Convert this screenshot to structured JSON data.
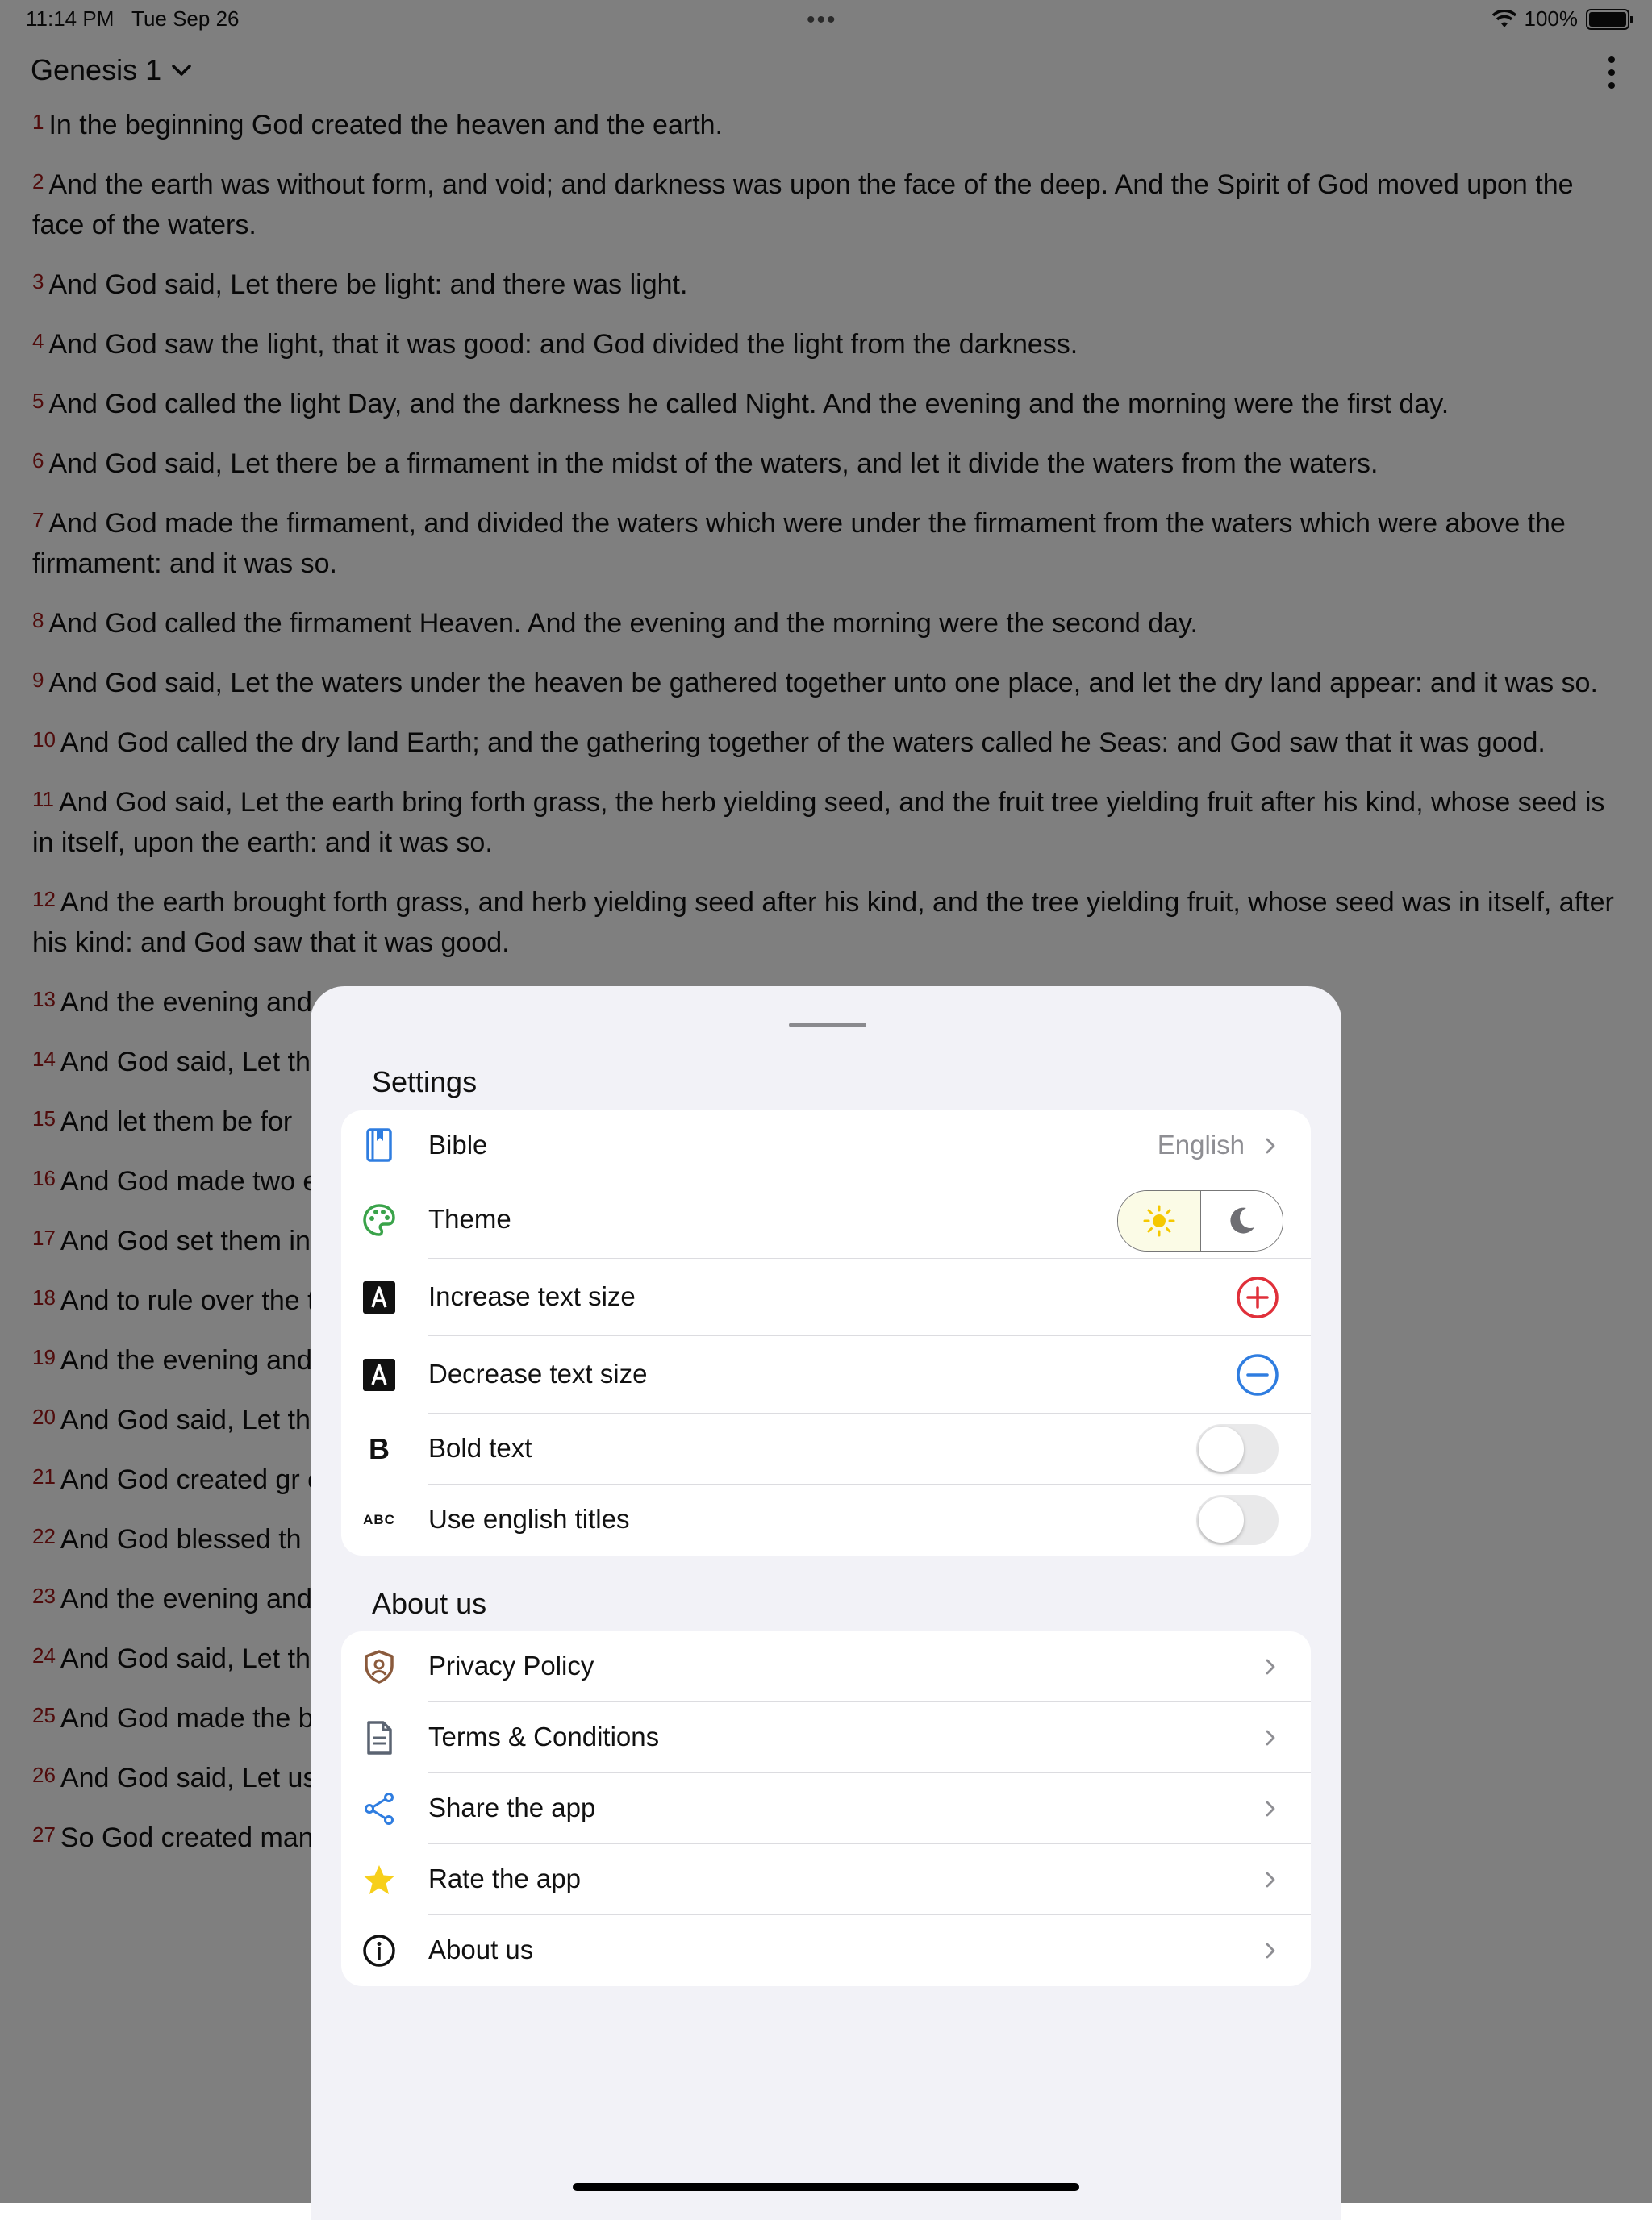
{
  "status_bar": {
    "time": "11:14 PM",
    "date": "Tue Sep 26",
    "dots": "•••",
    "battery": "100%"
  },
  "header": {
    "book_chapter": "Genesis 1"
  },
  "verses": [
    {
      "n": "1",
      "t": "In the beginning God created the heaven and the earth."
    },
    {
      "n": "2",
      "t": "And the earth was without form, and void; and darkness was upon the face of the deep. And the Spirit of God moved upon the face of the waters."
    },
    {
      "n": "3",
      "t": "And God said, Let there be light: and there was light."
    },
    {
      "n": "4",
      "t": "And God saw the light, that it was good: and God divided the light from the darkness."
    },
    {
      "n": "5",
      "t": "And God called the light Day, and the darkness he called Night. And the evening and the morning were the first day."
    },
    {
      "n": "6",
      "t": "And God said, Let there be a firmament in the midst of the waters, and let it divide the waters from the waters."
    },
    {
      "n": "7",
      "t": "And God made the firmament, and divided the waters which were under the firmament from the waters which were above the firmament: and it was so."
    },
    {
      "n": "8",
      "t": "And God called the firmament Heaven. And the evening and the morning were the second day."
    },
    {
      "n": "9",
      "t": "And God said, Let the waters under the heaven be gathered together unto one place, and let the dry land appear: and it was so."
    },
    {
      "n": "10",
      "t": "And God called the dry land Earth; and the gathering together of the waters called he Seas: and God saw that it was good."
    },
    {
      "n": "11",
      "t": "And God said, Let the earth bring forth grass, the herb yielding seed, and the fruit tree yielding fruit after his kind, whose seed is in itself, upon the earth: and it was so."
    },
    {
      "n": "12",
      "t": "And the earth brought forth grass, and herb yielding seed after his kind, and the tree yielding fruit, whose seed was in itself, after his kind: and God saw that it was good."
    },
    {
      "n": "13",
      "t": "And the evening and"
    },
    {
      "n": "14",
      "t": "And God said, Let th                                                                                                       et them be for signs, and for seasons, and f"
    },
    {
      "n": "15",
      "t": "And let them be for"
    },
    {
      "n": "16",
      "t": "And God made two                                                                                                       e made the stars also."
    },
    {
      "n": "17",
      "t": "And God set them in"
    },
    {
      "n": "18",
      "t": "And to rule over the                                                                                                       t it was good."
    },
    {
      "n": "19",
      "t": "And the evening and"
    },
    {
      "n": "20",
      "t": "And God said, Let th                                                                                                       ay fly above the earth in the open firmament"
    },
    {
      "n": "21",
      "t": "And God created gr                                                                                                       oundantly, after their kind, and every winged"
    },
    {
      "n": "22",
      "t": "And God blessed th                                                                                                       iply in the earth."
    },
    {
      "n": "23",
      "t": "And the evening and"
    },
    {
      "n": "24",
      "t": "And God said, Let th                                                                                                       beast of the earth after his kind: and it w"
    },
    {
      "n": "25",
      "t": "And God made the b                                                                                                       eps upon the earth after his kind: and God"
    },
    {
      "n": "26",
      "t": "And God said, Let us                                                                                                       ish of the sea, and over the fowl of the air                                                                                                       ps upon the earth."
    },
    {
      "n": "27",
      "t": "So God created man                                                                                                       e them."
    }
  ],
  "settings": {
    "title": "Settings",
    "bible": {
      "label": "Bible",
      "value": "English"
    },
    "theme": {
      "label": "Theme"
    },
    "increase": {
      "label": "Increase text size"
    },
    "decrease": {
      "label": "Decrease text size"
    },
    "bold": {
      "label": "Bold text",
      "on": false
    },
    "english_titles": {
      "label": "Use english titles",
      "on": false
    }
  },
  "about": {
    "title": "About us",
    "items": [
      {
        "label": "Privacy Policy",
        "icon": "shield-icon"
      },
      {
        "label": "Terms & Conditions",
        "icon": "document-icon"
      },
      {
        "label": "Share the app",
        "icon": "share-icon"
      },
      {
        "label": "Rate the app",
        "icon": "star-icon"
      },
      {
        "label": "About us",
        "icon": "info-icon"
      }
    ]
  },
  "colors": {
    "verse_number": "#a01818",
    "theme_icon": "#3aa34a",
    "add": "#e0303a",
    "remove": "#2f7de0",
    "star": "#f7cf1a"
  }
}
